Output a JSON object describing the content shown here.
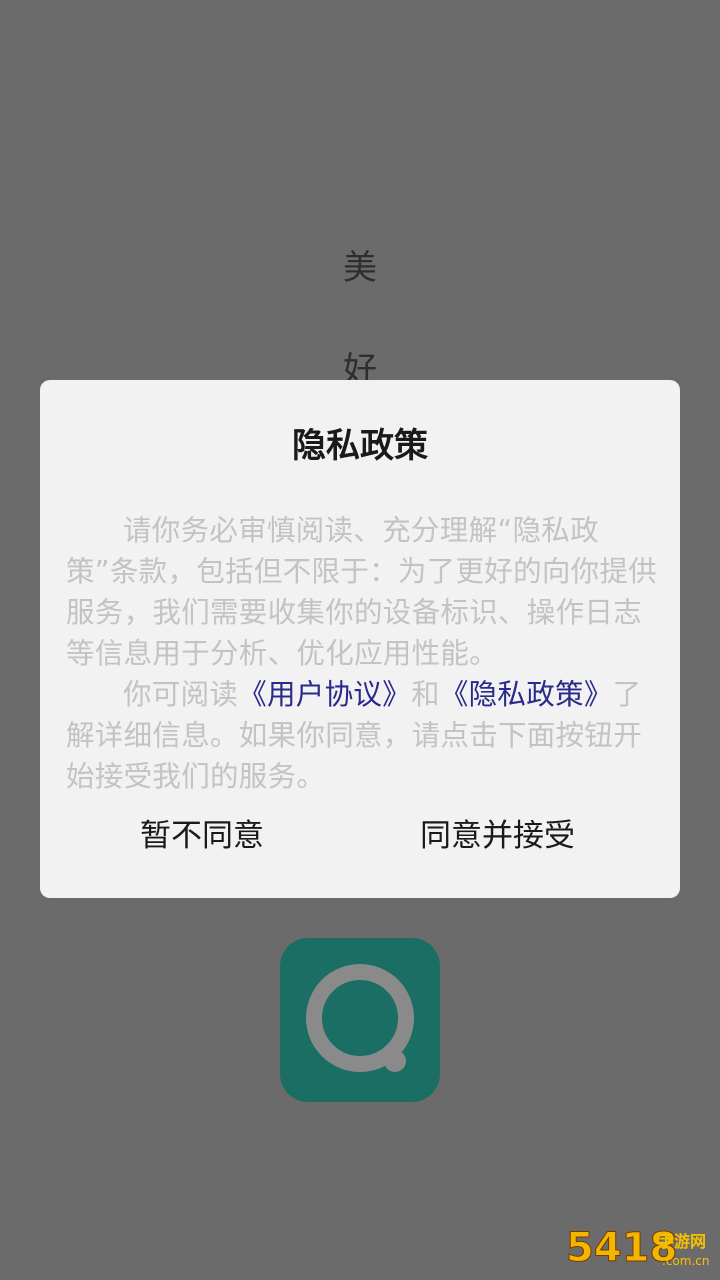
{
  "splash": {
    "char1": "美",
    "char2": "好"
  },
  "dialog": {
    "title": "隐私政策",
    "para1": "请你务必审慎阅读、充分理解“隐私政策”条款，包括但不限于：为了更好的向你提供服务，我们需要收集你的设备标识、操作日志等信息用于分析、优化应用性能。",
    "para2_prefix": "你可阅读",
    "link_user_agreement": "《用户协议》",
    "para2_and": "和",
    "link_privacy_policy": "《隐私政策》",
    "para2_suffix": "了解详细信息。如果你同意，请点击下面按钮开始接受我们的服务。",
    "decline_label": "暂不同意",
    "accept_label": "同意并接受"
  },
  "watermark": {
    "number": "5418",
    "site": "手游网",
    "domain": ".com.cn"
  },
  "colors": {
    "overlay": "#6b6b6b",
    "dialog_bg": "#f2f2f2",
    "link": "#2a2a8c",
    "app_icon": "#1b6e63"
  },
  "icons": {
    "app": "app-logo-icon"
  }
}
